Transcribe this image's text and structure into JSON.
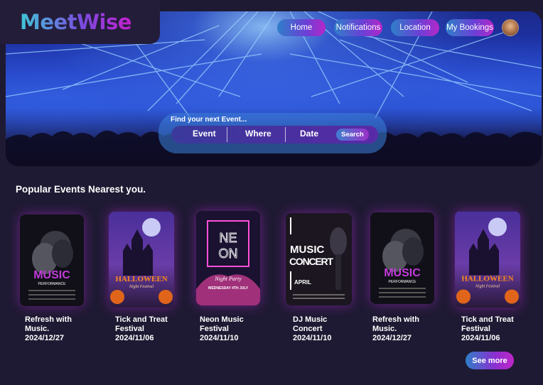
{
  "brand": {
    "name": "MeetWise"
  },
  "nav": {
    "home": "Home",
    "notifications": "Notifications",
    "location": "Location",
    "bookings": "My Bookings"
  },
  "search": {
    "caption": "Find your next Event...",
    "event": "Event",
    "where": "Where",
    "date": "Date",
    "button": "Search"
  },
  "section_title": "Popular Events Nearest you.",
  "events": [
    {
      "name": "Refresh with Music.",
      "date": "2024/12/27",
      "poster_text": "MUSIC",
      "poster_sub": "PERFORMANCE"
    },
    {
      "name": "Tick and Treat Festival",
      "date": "2024/11/06",
      "poster_text": "HALLOWEEN",
      "poster_sub": "Night Festival"
    },
    {
      "name": "Neon Music Festival",
      "date": "2024/11/10",
      "poster_text": "NEON",
      "poster_sub": "Night Party",
      "poster_date": "WEDNESDAY 4TH JULY"
    },
    {
      "name": "DJ Music Concert",
      "date": "2024/11/10",
      "poster_text": "MUSIC",
      "poster_sub": "CONCERT",
      "poster_date": "APRIL"
    },
    {
      "name": "Refresh with Music.",
      "date": "2024/12/27",
      "poster_text": "MUSIC",
      "poster_sub": "PERFORMANCE"
    },
    {
      "name": "Tick and Treat Festival",
      "date": "2024/11/06",
      "poster_text": "HALLOWEEN",
      "poster_sub": "Night Festival"
    }
  ],
  "see_more": "See more",
  "colors": {
    "background": "#1f1a33",
    "accent_blue": "#2f7fc9",
    "accent_purple": "#b527c8"
  }
}
